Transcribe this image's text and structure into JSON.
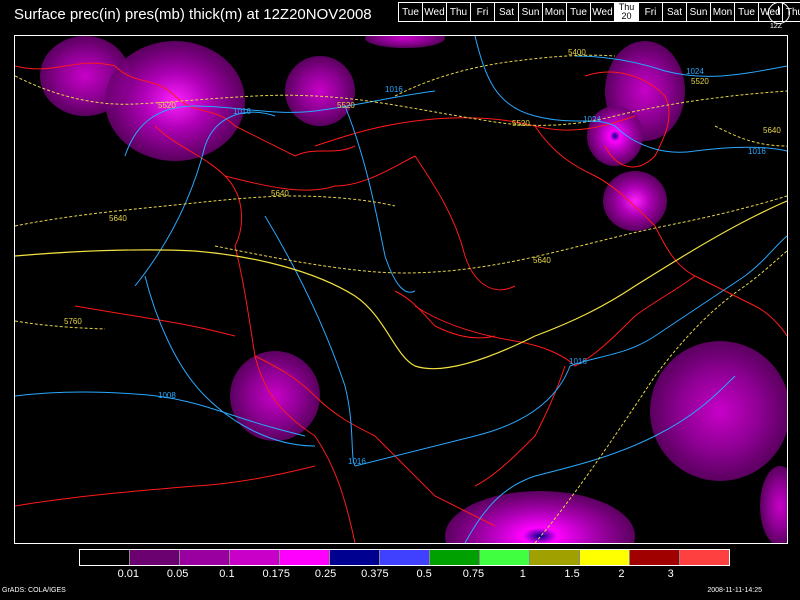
{
  "title": "Surface prec(in) pres(mb) thick(m) at 12Z20NOV2008",
  "days": [
    "Tue",
    "Wed",
    "Thu",
    "Fri",
    "Sat",
    "Sun",
    "Mon",
    "Tue",
    "Wed",
    "Thu",
    "Fri",
    "Sat",
    "Sun",
    "Mon",
    "Tue",
    "Wed",
    "Thu"
  ],
  "active_day": {
    "name": "Thu",
    "date": "20"
  },
  "clock_label": "12Z",
  "legend": {
    "colors": [
      "#000000",
      "#6b0070",
      "#9a00a0",
      "#c800c8",
      "#ff00ff",
      "#000090",
      "#4040ff",
      "#00a000",
      "#40ff40",
      "#a0a000",
      "#ffff00",
      "#a00000",
      "#ff4040"
    ],
    "labels": [
      "0.01",
      "0.05",
      "0.1",
      "0.175",
      "0.25",
      "0.375",
      "0.5",
      "0.75",
      "1",
      "1.5",
      "2",
      "3"
    ]
  },
  "map_labels": {
    "pres_1016_a": "1016",
    "pres_1016_b": "1016",
    "pres_1016_c": "1016",
    "pres_1016_d": "1016",
    "pres_1016_e": "1016",
    "pres_1024_a": "1024",
    "pres_1024_b": "1024",
    "pres_1008": "1008",
    "thick_5520_a": "5520",
    "thick_5520_b": "5520",
    "thick_5520_c": "5520",
    "thick_5520_d": "5520",
    "thick_5400": "5400",
    "thick_5640_a": "5640",
    "thick_5640_b": "5640",
    "thick_5640_c": "5640",
    "thick_5640_d": "5640",
    "thick_5760": "5760"
  },
  "credit": "GrADS: COLA/IGES",
  "timestamp": "2008-11-11-14:25"
}
